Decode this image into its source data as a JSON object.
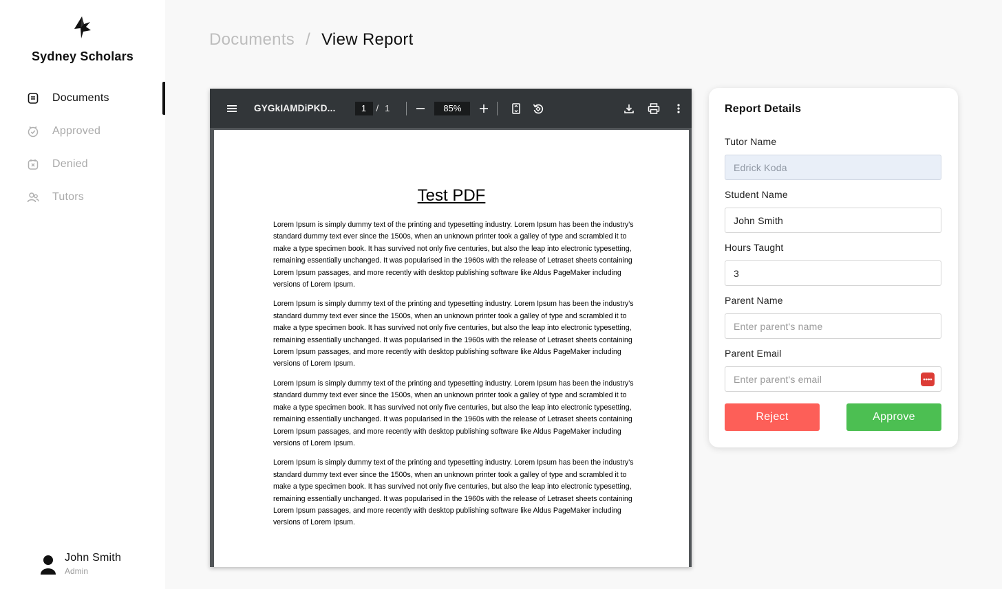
{
  "app": {
    "name": "Sydney Scholars",
    "logo_icon": "bird-logo-icon"
  },
  "sidebar": {
    "items": [
      {
        "label": "Documents",
        "icon": "document-icon",
        "active": true
      },
      {
        "label": "Approved",
        "icon": "calendar-check-icon",
        "active": false
      },
      {
        "label": "Denied",
        "icon": "calendar-x-icon",
        "active": false
      },
      {
        "label": "Tutors",
        "icon": "users-icon",
        "active": false
      }
    ],
    "user": {
      "name": "John Smith",
      "role": "Admin"
    }
  },
  "breadcrumb": {
    "parent": "Documents",
    "separator": "/",
    "current": "View Report"
  },
  "viewer": {
    "filename": "GYGkIAMDiPKD...",
    "page_current": "1",
    "page_separator": "/",
    "page_total": "1",
    "zoom": "85%",
    "document": {
      "title": "Test PDF",
      "paragraphs": [
        "Lorem Ipsum is simply dummy text of the printing and typesetting industry. Lorem Ipsum has been the industry's standard dummy text ever since the 1500s, when an unknown printer took a galley of type and scrambled it to make a type specimen book. It has survived not only five centuries, but also the leap into electronic typesetting, remaining essentially unchanged. It was popularised in the 1960s with the release of Letraset sheets containing Lorem Ipsum passages, and more recently with desktop publishing software like Aldus PageMaker including versions of Lorem Ipsum.",
        "Lorem Ipsum is simply dummy text of the printing and typesetting industry. Lorem Ipsum has been the industry's standard dummy text ever since the 1500s, when an unknown printer took a galley of type and scrambled it to make a type specimen book. It has survived not only five centuries, but also the leap into electronic typesetting, remaining essentially unchanged. It was popularised in the 1960s with the release of Letraset sheets containing Lorem Ipsum passages, and more recently with desktop publishing software like Aldus PageMaker including versions of Lorem Ipsum.",
        "Lorem Ipsum is simply dummy text of the printing and typesetting industry. Lorem Ipsum has been the industry's standard dummy text ever since the 1500s, when an unknown printer took a galley of type and scrambled it to make a type specimen book. It has survived not only five centuries, but also the leap into electronic typesetting, remaining essentially unchanged. It was popularised in the 1960s with the release of Letraset sheets containing Lorem Ipsum passages, and more recently with desktop publishing software like Aldus PageMaker including versions of Lorem Ipsum.",
        "Lorem Ipsum is simply dummy text of the printing and typesetting industry. Lorem Ipsum has been the industry's standard dummy text ever since the 1500s, when an unknown printer took a galley of type and scrambled it to make a type specimen book. It has survived not only five centuries, but also the leap into electronic typesetting, remaining essentially unchanged. It was popularised in the 1960s with the release of Letraset sheets containing Lorem Ipsum passages, and more recently with desktop publishing software like Aldus PageMaker including versions of Lorem Ipsum."
      ]
    }
  },
  "report": {
    "title": "Report Details",
    "tutor_name": {
      "label": "Tutor Name",
      "value": "Edrick Koda",
      "readonly": true
    },
    "student_name": {
      "label": "Student Name",
      "value": "John Smith"
    },
    "hours_taught": {
      "label": "Hours Taught",
      "value": "3"
    },
    "parent_name": {
      "label": "Parent Name",
      "value": "",
      "placeholder": "Enter parent's name"
    },
    "parent_email": {
      "label": "Parent Email",
      "value": "",
      "placeholder": "Enter parent's email"
    },
    "reject_label": "Reject",
    "approve_label": "Approve"
  },
  "colors": {
    "reject": "#fd5f58",
    "approve": "#4cbf52",
    "readonly_bg": "#e9eff8",
    "toolbar_bg": "#323639",
    "password_badge": "#dc3c36"
  }
}
